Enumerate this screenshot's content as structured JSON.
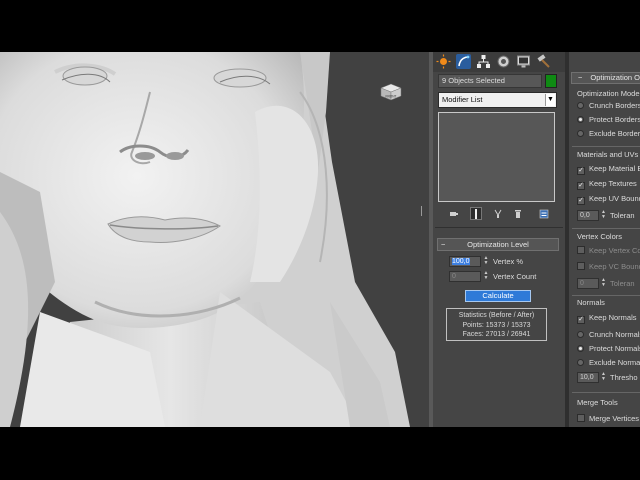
{
  "command_panel": {
    "tabs": [
      {
        "name": "create-tab",
        "icon": "sun-icon"
      },
      {
        "name": "modify-tab",
        "icon": "curve-icon"
      },
      {
        "name": "hierarchy-tab",
        "icon": "hierarchy-icon"
      },
      {
        "name": "motion-tab",
        "icon": "motion-icon"
      },
      {
        "name": "display-tab",
        "icon": "monitor-icon"
      },
      {
        "name": "utilities-tab",
        "icon": "hammer-icon"
      }
    ],
    "selection_text": "9 Objects Selected",
    "selection_color": "#0f8a13",
    "modifier_list": "Modifier List",
    "accent_color": "#2e7ad8"
  },
  "optimization_level": {
    "title": "Optimization Level",
    "vertex_percent_value": "100,0",
    "vertex_percent_label": "Vertex %",
    "vertex_count_value": "0",
    "vertex_count_label": "Vertex Count",
    "calculate_label": "Calculate",
    "stats_title": "Statistics (Before / After)",
    "stats_points": "Points: 15373 / 15373",
    "stats_faces": "Faces: 27013 / 26941"
  },
  "optimization_options": {
    "title": "Optimization O",
    "optimization_mode": {
      "label": "Optimization Mode",
      "crunch": "Crunch Borders",
      "protect": "Protect Borders",
      "exclude": "Exclude Borders"
    },
    "materials_uvs": {
      "label": "Materials and UVs",
      "keep_material": "Keep Material B",
      "keep_textures": "Keep Textures",
      "keep_uv": "Keep UV Bound",
      "tolerance_value": "0,0",
      "tolerance_label": "Toleran"
    },
    "vertex_colors": {
      "label": "Vertex Colors",
      "keep_vertex": "Keep Vertex Co",
      "keep_vc": "Keep VC Bound",
      "tolerance_value": "0",
      "tolerance_label": "Toleran"
    },
    "normals": {
      "label": "Normals",
      "keep_normals": "Keep Normals",
      "crunch": "Crunch Normals",
      "protect": "Protect Normals",
      "exclude": "Exclude Normals",
      "threshold_value": "10,0",
      "threshold_label": "Thresho"
    },
    "merge_tools": {
      "label": "Merge Tools",
      "merge_vertices": "Merge Vertices"
    }
  }
}
